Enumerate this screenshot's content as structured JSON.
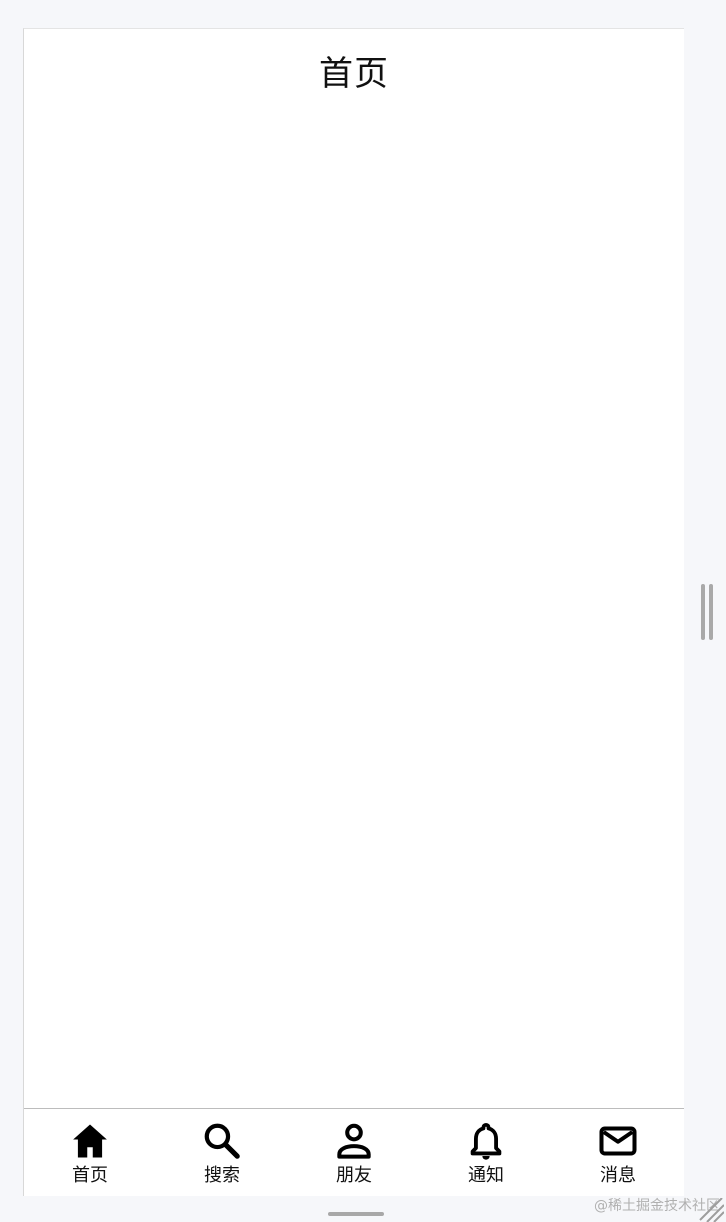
{
  "header": {
    "title": "首页"
  },
  "tabbar": {
    "items": [
      {
        "label": "首页",
        "icon": "home-icon"
      },
      {
        "label": "搜索",
        "icon": "search-icon"
      },
      {
        "label": "朋友",
        "icon": "person-icon"
      },
      {
        "label": "通知",
        "icon": "bell-icon"
      },
      {
        "label": "消息",
        "icon": "mail-icon"
      }
    ]
  },
  "watermark": {
    "text": "@稀土掘金技术社区"
  },
  "colors": {
    "background": "#f6f7fa",
    "surface": "#ffffff",
    "text": "#111111",
    "divider": "#bcbcbc"
  }
}
